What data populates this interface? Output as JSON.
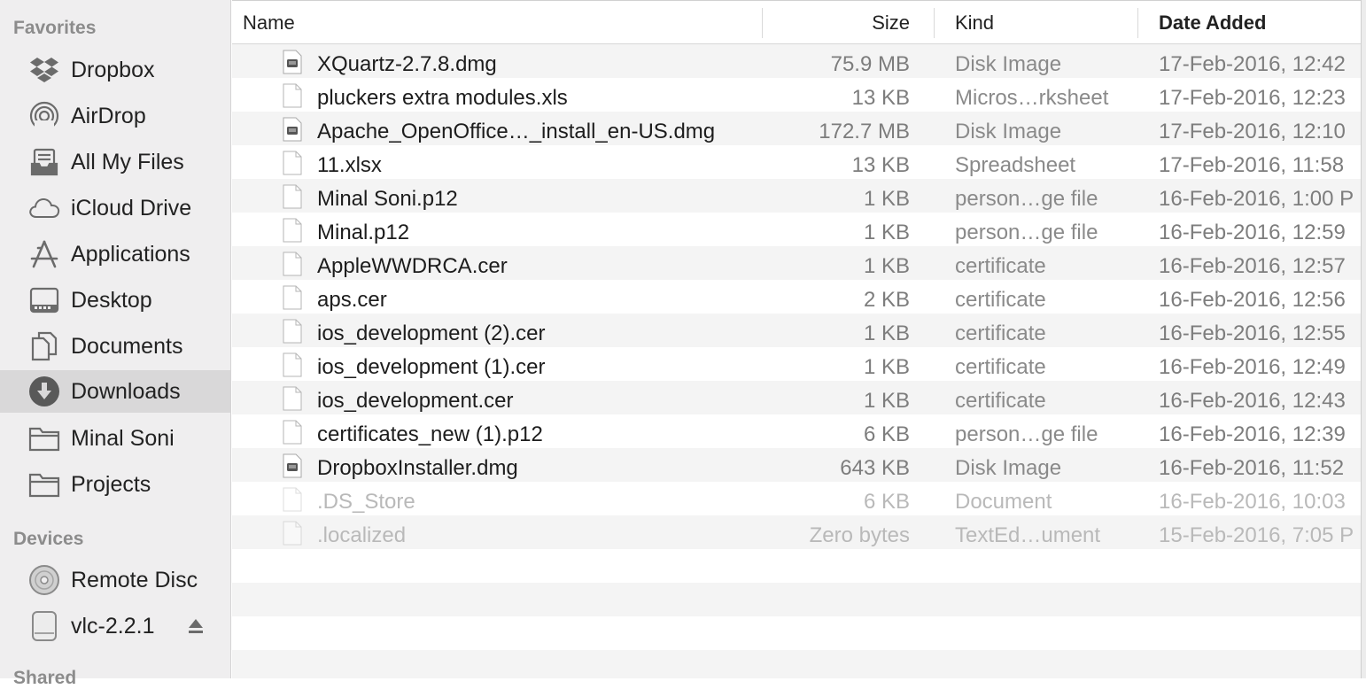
{
  "sidebar": {
    "favorites_label": "Favorites",
    "devices_label": "Devices",
    "shared_label": "Shared",
    "favorites": [
      {
        "label": "Dropbox",
        "icon": "dropbox-icon"
      },
      {
        "label": "AirDrop",
        "icon": "airdrop-icon"
      },
      {
        "label": "All My Files",
        "icon": "all-my-files-icon"
      },
      {
        "label": "iCloud Drive",
        "icon": "icloud-icon"
      },
      {
        "label": "Applications",
        "icon": "applications-icon"
      },
      {
        "label": "Desktop",
        "icon": "desktop-icon"
      },
      {
        "label": "Documents",
        "icon": "documents-icon"
      },
      {
        "label": "Downloads",
        "icon": "downloads-icon",
        "selected": true
      },
      {
        "label": "Minal Soni",
        "icon": "folder-icon"
      },
      {
        "label": "Projects",
        "icon": "folder-icon"
      }
    ],
    "devices": [
      {
        "label": "Remote Disc",
        "icon": "disc-icon"
      },
      {
        "label": "vlc-2.2.1",
        "icon": "disk-image-icon",
        "eject": true
      }
    ]
  },
  "list": {
    "columns": {
      "name": "Name",
      "size": "Size",
      "kind": "Kind",
      "date_added": "Date Added"
    },
    "rows": [
      {
        "name": "XQuartz-2.7.8.dmg",
        "size": "75.9 MB",
        "kind": "Disk Image",
        "date": "17-Feb-2016, 12:42",
        "icon": "dmg"
      },
      {
        "name": "pluckers extra modules.xls",
        "size": "13 KB",
        "kind": "Micros…rksheet",
        "date": "17-Feb-2016, 12:23",
        "icon": "doc"
      },
      {
        "name": "Apache_OpenOffice…_install_en-US.dmg",
        "size": "172.7 MB",
        "kind": "Disk Image",
        "date": "17-Feb-2016, 12:10",
        "icon": "dmg"
      },
      {
        "name": "11.xlsx",
        "size": "13 KB",
        "kind": "Spreadsheet",
        "date": "17-Feb-2016, 11:58",
        "icon": "doc"
      },
      {
        "name": "Minal Soni.p12",
        "size": "1 KB",
        "kind": "person…ge file",
        "date": "16-Feb-2016, 1:00 P",
        "icon": "doc"
      },
      {
        "name": "Minal.p12",
        "size": "1 KB",
        "kind": "person…ge file",
        "date": "16-Feb-2016, 12:59",
        "icon": "doc"
      },
      {
        "name": "AppleWWDRCA.cer",
        "size": "1 KB",
        "kind": "certificate",
        "date": "16-Feb-2016, 12:57",
        "icon": "doc"
      },
      {
        "name": "aps.cer",
        "size": "2 KB",
        "kind": "certificate",
        "date": "16-Feb-2016, 12:56",
        "icon": "doc"
      },
      {
        "name": "ios_development (2).cer",
        "size": "1 KB",
        "kind": "certificate",
        "date": "16-Feb-2016, 12:55",
        "icon": "doc"
      },
      {
        "name": "ios_development (1).cer",
        "size": "1 KB",
        "kind": "certificate",
        "date": "16-Feb-2016, 12:49",
        "icon": "doc"
      },
      {
        "name": "ios_development.cer",
        "size": "1 KB",
        "kind": "certificate",
        "date": "16-Feb-2016, 12:43",
        "icon": "doc"
      },
      {
        "name": "certificates_new (1).p12",
        "size": "6 KB",
        "kind": "person…ge file",
        "date": "16-Feb-2016, 12:39",
        "icon": "doc"
      },
      {
        "name": "DropboxInstaller.dmg",
        "size": "643 KB",
        "kind": "Disk Image",
        "date": "16-Feb-2016, 11:52",
        "icon": "dmg"
      },
      {
        "name": ".DS_Store",
        "size": "6 KB",
        "kind": "Document",
        "date": "16-Feb-2016, 10:03",
        "icon": "doc",
        "hidden": true
      },
      {
        "name": ".localized",
        "size": "Zero bytes",
        "kind": "TextEd…ument",
        "date": "15-Feb-2016, 7:05 P",
        "icon": "doc",
        "hidden": true
      }
    ]
  },
  "colors": {
    "sidebar_bg": "#efeeef",
    "selected_bg": "#d9d8d9",
    "alt_row": "#f4f4f4"
  }
}
